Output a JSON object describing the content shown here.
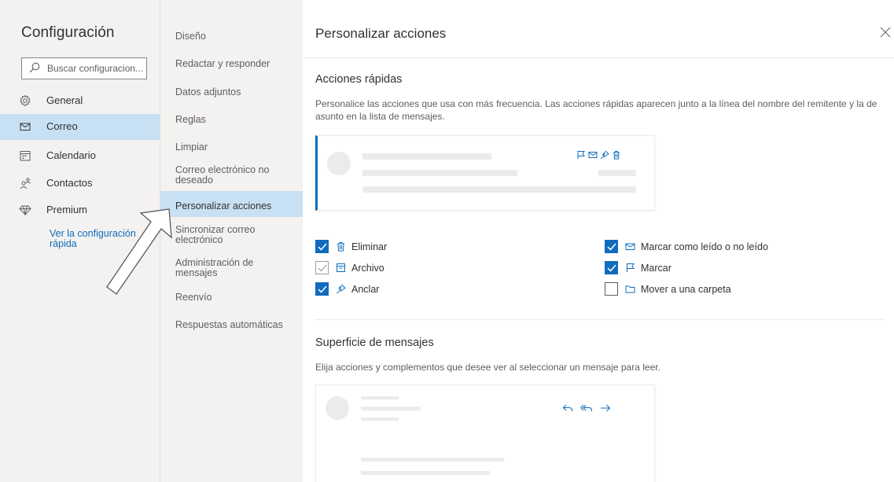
{
  "left": {
    "title": "Configuración",
    "search_placeholder": "Buscar configuracion...",
    "categories": [
      {
        "label": "General",
        "icon": "gear-icon"
      },
      {
        "label": "Correo",
        "icon": "mail-icon",
        "selected": true
      },
      {
        "label": "Calendario",
        "icon": "calendar-icon"
      },
      {
        "label": "Contactos",
        "icon": "people-icon"
      },
      {
        "label": "Premium",
        "icon": "diamond-icon"
      }
    ],
    "quick_link": "Ver la configuración rápida"
  },
  "middle": {
    "items": [
      {
        "label": "Diseño"
      },
      {
        "label": "Redactar y responder"
      },
      {
        "label": "Datos adjuntos"
      },
      {
        "label": "Reglas"
      },
      {
        "label": "Limpiar"
      },
      {
        "label": "Correo electrónico no deseado"
      },
      {
        "label": "Personalizar acciones",
        "selected": true
      },
      {
        "label": "Sincronizar correo electrónico"
      },
      {
        "label": "Administración de mensajes"
      },
      {
        "label": "Reenvío"
      },
      {
        "label": "Respuestas automáticas"
      }
    ]
  },
  "panel": {
    "title": "Personalizar acciones",
    "quick_actions": {
      "heading": "Acciones rápidas",
      "description": "Personalice las acciones que usa con más frecuencia. Las acciones rápidas aparecen junto a la línea del nombre del remitente y la de asunto en la lista de mensajes.",
      "options": [
        {
          "label": "Eliminar",
          "icon": "trash-icon",
          "checked": true
        },
        {
          "label": "Archivo",
          "icon": "archive-icon",
          "checked": false,
          "partial": true
        },
        {
          "label": "Anclar",
          "icon": "pin-icon",
          "checked": true
        },
        {
          "label": "Marcar como leído o no leído",
          "icon": "envelope-icon",
          "checked": true
        },
        {
          "label": "Marcar",
          "icon": "flag-icon",
          "checked": true
        },
        {
          "label": "Mover a una carpeta",
          "icon": "folder-icon",
          "checked": false
        }
      ]
    },
    "message_surface": {
      "heading": "Superficie de mensajes",
      "description": "Elija acciones y complementos que desee ver al seleccionar un mensaje para leer."
    }
  },
  "colors": {
    "accent": "#0f6cbd",
    "selected_bg": "#c7e0f4",
    "sidebar_bg": "#f3f2f1",
    "placeholder_gray": "#ecebea"
  }
}
